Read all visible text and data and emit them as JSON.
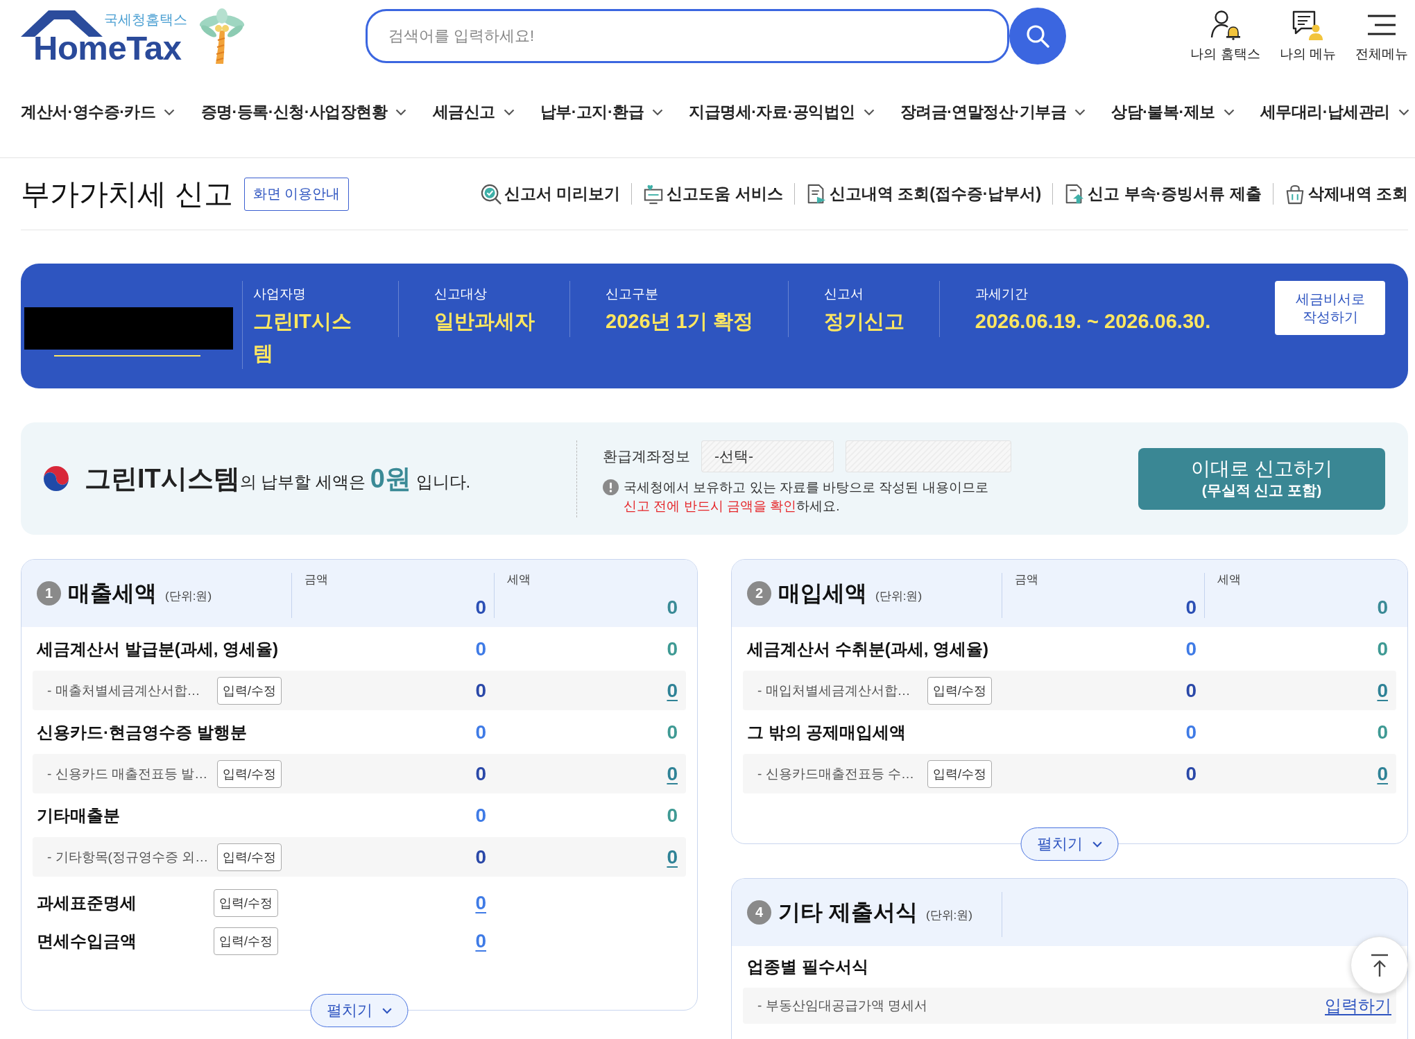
{
  "header": {
    "logo": {
      "subtitle": "국세청홈택스",
      "name": "HomeTax"
    },
    "search": {
      "placeholder": "검색어를 입력하세요!"
    },
    "quick_menu": [
      {
        "kind": "account",
        "label": "나의 홈택스"
      },
      {
        "kind": "mymenu",
        "label": "나의 메뉴"
      },
      {
        "kind": "allmenu",
        "label": "전체메뉴"
      }
    ]
  },
  "nav": [
    "계산서·영수증·카드",
    "증명·등록·신청·사업장현황",
    "세금신고",
    "납부·고지·환급",
    "지급명세·자료·공익법인",
    "장려금·연말정산·기부금",
    "상담·불복·제보",
    "세무대리·납세관리"
  ],
  "page": {
    "title": "부가가치세 신고",
    "guide_button": "화면 이용안내",
    "links": [
      {
        "kind": "preview",
        "label": "신고서 미리보기"
      },
      {
        "kind": "help",
        "label": "신고도움 서비스"
      },
      {
        "kind": "history",
        "label": "신고내역 조회(접수증·납부서)"
      },
      {
        "kind": "attach",
        "label": "신고 부속·증빙서류 제출"
      },
      {
        "kind": "deleted",
        "label": "삭제내역 조회"
      }
    ]
  },
  "filing_info": {
    "business_number": {
      "redacted": true
    },
    "fields": [
      {
        "label": "사업자명",
        "value": "그린IT시스템"
      },
      {
        "label": "신고대상",
        "value": "일반과세자"
      },
      {
        "label": "신고구분",
        "value": "2026년 1기 확정"
      },
      {
        "label": "신고서",
        "value": "정기신고"
      },
      {
        "label": "과세기간",
        "value": "2026.06.19. ~ 2026.06.30."
      }
    ],
    "button": "세금비서로 작성하기"
  },
  "summary": {
    "sentence": "**그린IT시스템**의 납부할 세액은 **0원** 입니다.",
    "refund_account": {
      "label": "환급계좌정보",
      "bank": {
        "value": "-선택-",
        "disabled": true
      },
      "account": {
        "disabled": true
      }
    },
    "notice": {
      "text": "국세청에서 보유하고 있는 자료를 바탕으로 작성된 내용이므로",
      "highlight": "신고 전에 반드시 금액을 확인",
      "tail": "하세요."
    },
    "submit_button": {
      "label": "이대로 신고하기",
      "sublabel": "(무실적 신고 포함)"
    }
  },
  "sections": [
    {
      "number": "1",
      "title": "매출세액",
      "unit": "(단위:원)",
      "columns": [
        {
          "label": "금액",
          "total": "0"
        },
        {
          "label": "세액",
          "total": "0"
        }
      ],
      "rows": [
        {
          "kind": "group",
          "label": "세금계산서 발급분(과세, 영세율)",
          "amount": "0",
          "tax": "0"
        },
        {
          "kind": "detail",
          "label": "- 매출처별세금계산서합…",
          "button": "입력/수정",
          "amount": "0",
          "tax": "0"
        },
        {
          "kind": "group",
          "label": "신용카드·현금영수증 발행분",
          "amount": "0",
          "tax": "0"
        },
        {
          "kind": "detail",
          "label": "- 신용카드 매출전표등 발…",
          "button": "입력/수정",
          "amount": "0",
          "tax": "0"
        },
        {
          "kind": "group",
          "label": "기타매출분",
          "amount": "0",
          "tax": "0"
        },
        {
          "kind": "detail",
          "label": "- 기타항목(정규영수증 외…",
          "button": "입력/수정",
          "amount": "0",
          "tax": "0"
        },
        {
          "kind": "entry",
          "label": "과세표준명세",
          "button": "입력/수정",
          "amount": "0"
        },
        {
          "kind": "entry",
          "label": "면세수입금액",
          "button": "입력/수정",
          "amount": "0"
        }
      ],
      "expand_button": "펼치기"
    },
    {
      "number": "2",
      "title": "매입세액",
      "unit": "(단위:원)",
      "columns": [
        {
          "label": "금액",
          "total": "0"
        },
        {
          "label": "세액",
          "total": "0"
        }
      ],
      "rows": [
        {
          "kind": "group",
          "label": "세금계산서 수취분(과세, 영세율)",
          "amount": "0",
          "tax": "0"
        },
        {
          "kind": "detail",
          "label": "- 매입처별세금계산서합…",
          "button": "입력/수정",
          "amount": "0",
          "tax": "0"
        },
        {
          "kind": "group",
          "label": "그 밖의 공제매입세액",
          "amount": "0",
          "tax": "0"
        },
        {
          "kind": "detail",
          "label": "- 신용카드매출전표등 수…",
          "button": "입력/수정",
          "amount": "0",
          "tax": "0"
        }
      ],
      "expand_button": "펼치기"
    },
    {
      "number": "4",
      "title": "기타 제출서식",
      "unit": "(단위:원)",
      "rows": [
        {
          "kind": "heading",
          "label": "업종별 필수서식"
        },
        {
          "kind": "form",
          "label": "- 부동산임대공급가액 명세서",
          "link": "입력하기"
        }
      ]
    }
  ]
}
